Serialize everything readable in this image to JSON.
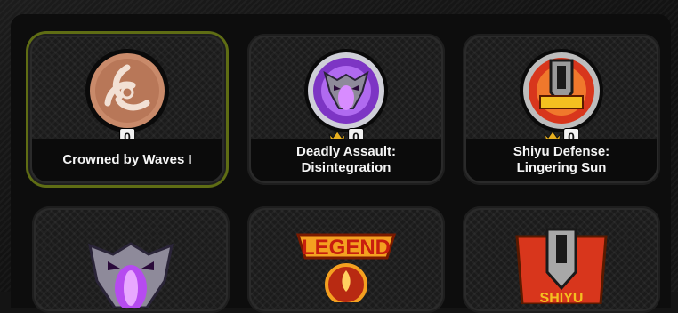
{
  "achievements": [
    {
      "title": "Crowned by Waves  I",
      "count": "0",
      "crown": false,
      "selected": true
    },
    {
      "title": "Deadly Assault:\nDisintegration",
      "count": "0",
      "crown": true,
      "selected": false
    },
    {
      "title": "Shiyu Defense:\nLingering Sun",
      "count": "0",
      "crown": true,
      "selected": false
    }
  ],
  "partial_row": {
    "legend_emblem_text": "LEGEND",
    "shiyu_emblem_text": "SHIYU"
  },
  "colors": {
    "selected_border": "#5f6d14",
    "crown": "#e8b020",
    "bronze": "#c98a6a",
    "violet": "#9b4de0",
    "shiyu_red": "#d8361c"
  }
}
